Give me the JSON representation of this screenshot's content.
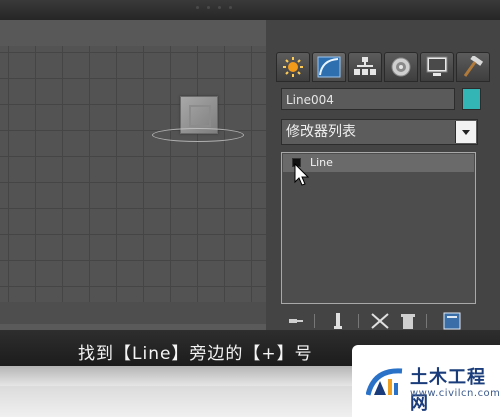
{
  "command_panel": {
    "tabs": [
      {
        "id": "create",
        "icon": "sun-star-icon"
      },
      {
        "id": "modify",
        "icon": "curve-modify-icon"
      },
      {
        "id": "hierarchy",
        "icon": "hierarchy-icon"
      },
      {
        "id": "motion",
        "icon": "motion-disc-icon"
      },
      {
        "id": "display",
        "icon": "monitor-icon"
      },
      {
        "id": "utilities",
        "icon": "hammer-icon"
      }
    ],
    "active_tab": "modify",
    "object_name": "Line004",
    "object_color": "#33b5b5",
    "modifier_list_label": "修改器列表",
    "stack": {
      "items": [
        {
          "label": "Line",
          "expand_toggle": "+"
        }
      ]
    }
  },
  "subtitle": {
    "text": "找到【Line】旁边的【+】号"
  },
  "watermark": {
    "site_name_cn": "土木工程网",
    "url": "www.civilcn.com",
    "brand_color": "#1a3c7a"
  }
}
